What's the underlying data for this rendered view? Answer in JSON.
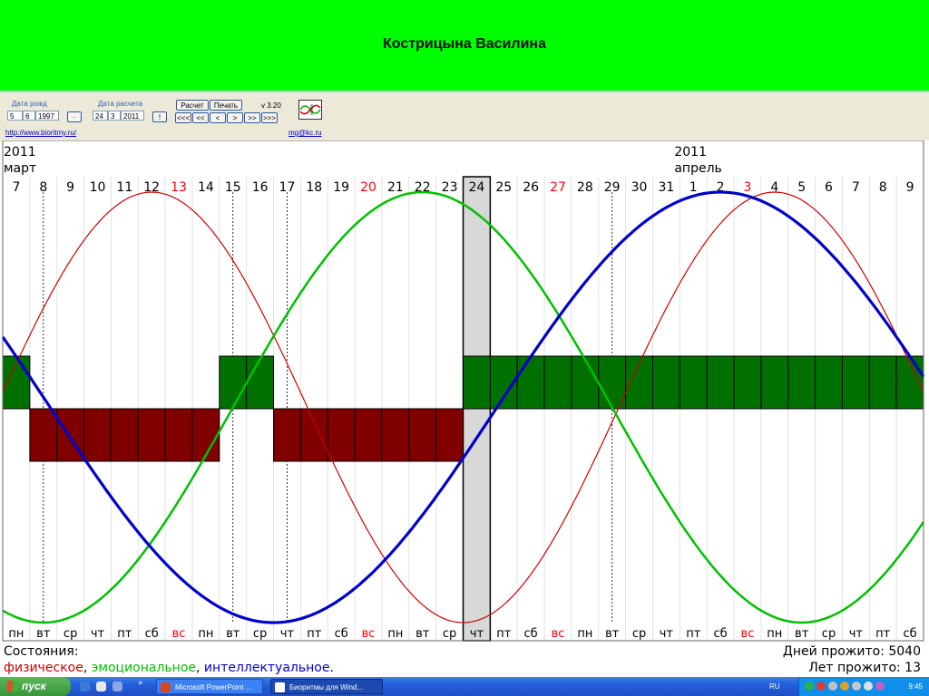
{
  "presentation": {
    "title": "Кострицына Василина"
  },
  "app": {
    "birth_label": "Дата рожд",
    "birth": {
      "day": "5",
      "month": "6",
      "year": "1997"
    },
    "calc_label": "Дата расчета",
    "calc": {
      "day": "24",
      "month": "3",
      "year": "2011"
    },
    "buttons": {
      "calc": "Расчет",
      "print": "Печать",
      "small1": "·",
      "small2": "!"
    },
    "nav": [
      "<<<",
      "<<",
      "<",
      ">",
      ">>",
      ">>>"
    ],
    "version": "v 3.20",
    "site_link": "http://www.bioritmy.ru/",
    "email_link": "mg@kc.ru"
  },
  "chart_data": {
    "type": "line",
    "title": "",
    "header": [
      {
        "year": "2011",
        "month": "март"
      },
      {
        "year": "2011",
        "month": "апрель"
      }
    ],
    "days": [
      "7",
      "8",
      "9",
      "10",
      "11",
      "12",
      "13",
      "14",
      "15",
      "16",
      "17",
      "18",
      "19",
      "20",
      "21",
      "22",
      "23",
      "24",
      "25",
      "26",
      "27",
      "28",
      "29",
      "30",
      "31",
      "1",
      "2",
      "3",
      "4",
      "5",
      "6",
      "7",
      "8",
      "9"
    ],
    "weekdays": [
      "пн",
      "вт",
      "ср",
      "чт",
      "пт",
      "сб",
      "вс",
      "пн",
      "вт",
      "ср",
      "чт",
      "пт",
      "сб",
      "вс",
      "пн",
      "вт",
      "ср",
      "чт",
      "пт",
      "сб",
      "вс",
      "пн",
      "вт",
      "ср",
      "чт",
      "пт",
      "сб",
      "вс",
      "пн",
      "вт",
      "ср",
      "чт",
      "пт",
      "сб"
    ],
    "weekend_color": "#ff0000",
    "highlight_day_index": 17,
    "dashed_day_indices": [
      1,
      8,
      10,
      22
    ],
    "series": [
      {
        "name": "физическое",
        "color": "#cc0000",
        "period": 23,
        "peak_day_index": 5,
        "width": 1.2
      },
      {
        "name": "эмоциональное",
        "color": "#00c000",
        "period": 28,
        "peak_day_index": 15,
        "width": 2.5
      },
      {
        "name": "интеллектуальное",
        "color": "#0000cc",
        "period": 33,
        "peak_day_index": 26,
        "width": 3.2
      }
    ],
    "state_bars": [
      "up",
      "down",
      "down",
      "down",
      "down",
      "down",
      "down",
      "down",
      "up",
      "up",
      "down",
      "down",
      "down",
      "down",
      "down",
      "down",
      "down",
      "up",
      "up",
      "up",
      "up",
      "up",
      "up",
      "up",
      "up",
      "up",
      "up",
      "up",
      "up",
      "up",
      "up",
      "up",
      "up",
      "up"
    ],
    "state_colors": {
      "up": "#007000",
      "down": "#800000"
    },
    "footer": {
      "states_label": "Состояния:",
      "physical": "физическое",
      "emotional": "эмоциональное",
      "intellectual": "интеллектуальное",
      "sep1": ", ",
      "sep2": ", ",
      "end": ".",
      "days_lived": "Дней прожито: 5040",
      "years_lived": "Лет прожито: 13"
    }
  },
  "taskbar": {
    "start_label": "пуск",
    "tasks": [
      "Microsoft PowerPoint ...",
      "Биоритмы для Wind..."
    ],
    "lang": "RU",
    "clock": "9:45",
    "chevron": "»"
  }
}
